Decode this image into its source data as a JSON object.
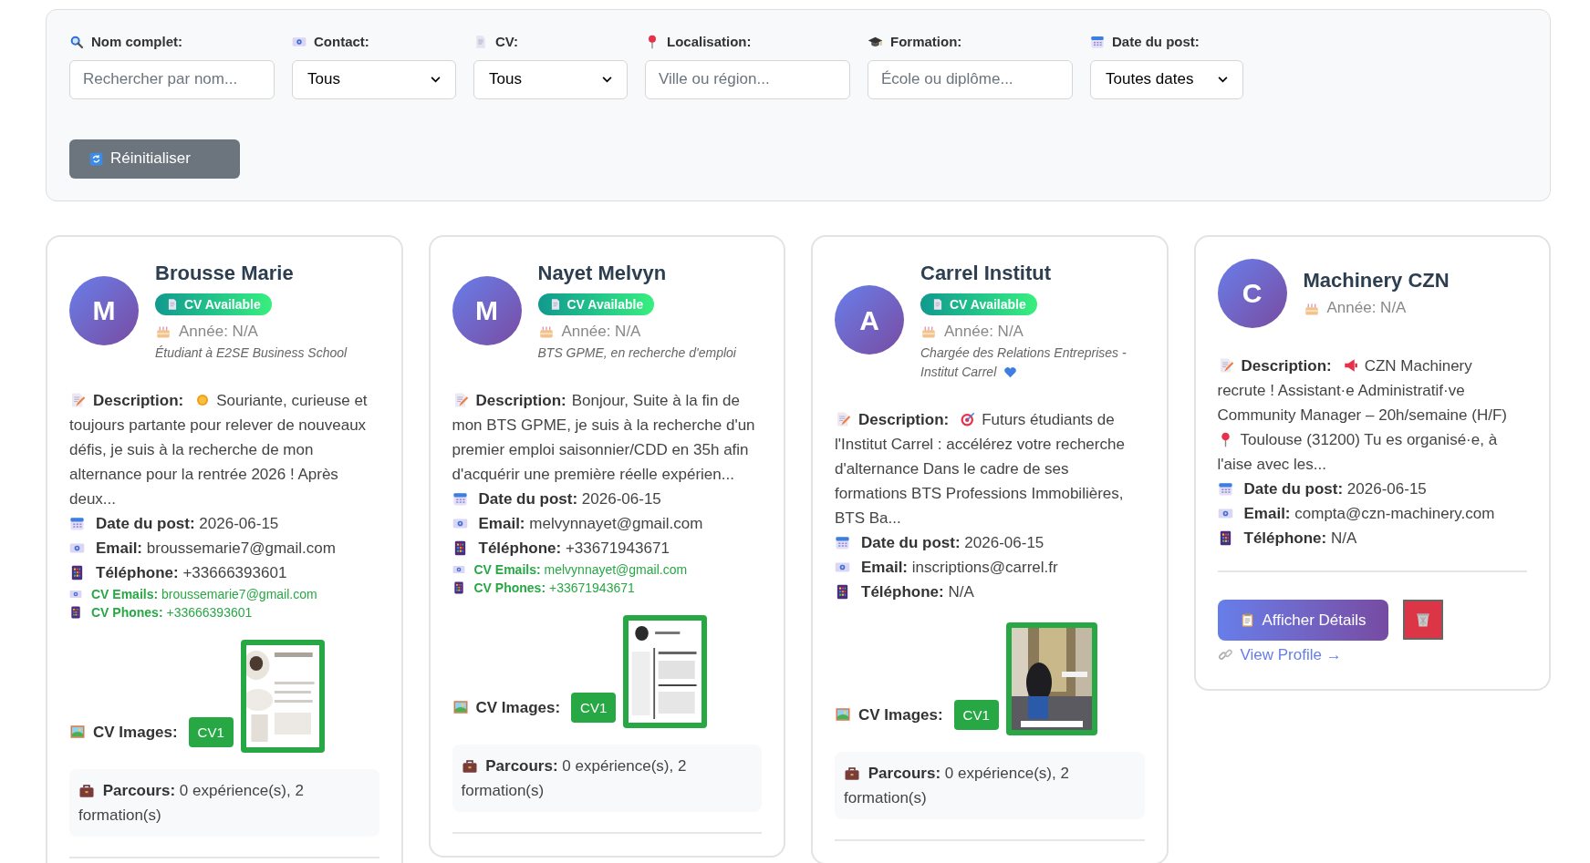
{
  "filters": [
    {
      "label": "Nom complet:",
      "kind": "text",
      "placeholder": "Rechercher par nom..."
    },
    {
      "label": "Contact:",
      "kind": "select",
      "value": "Tous"
    },
    {
      "label": "CV:",
      "kind": "select",
      "value": "Tous"
    },
    {
      "label": "Localisation:",
      "kind": "text",
      "placeholder": "Ville ou région..."
    },
    {
      "label": "Formation:",
      "kind": "text",
      "placeholder": "École ou diplôme..."
    },
    {
      "label": "Date du post:",
      "kind": "select",
      "value": "Toutes dates"
    }
  ],
  "reset_button": "Réinitialiser",
  "candidates": [
    {
      "avatar": "M",
      "name": "Brousse Marie",
      "cv_available": true,
      "cv_badge": "CV Available",
      "year": "Année: N/A",
      "headline": [
        {
          "kind": "text",
          "text": "Étudiant à E2SE Business School"
        }
      ],
      "description": {
        "label": "Description:",
        "parts": [
          {
            "kind": "sun"
          },
          {
            "kind": "text",
            "text": "Souriante, curieuse et"
          },
          {
            "kind": "paragraph",
            "text": "toujours partante pour relever de nouveaux défis, je suis à la recherche de mon alternance pour la rentrée 2026 ! Après deux..."
          }
        ]
      },
      "fields": [
        {
          "kind": "date",
          "label": "Date du post:",
          "value": "2026-06-15"
        },
        {
          "kind": "email",
          "label": "Email:",
          "value": "broussemarie7@gmail.com"
        },
        {
          "kind": "phone",
          "label": "Téléphone:",
          "value": "+33666393601"
        },
        {
          "kind": "cv_email",
          "label": "CV Emails:",
          "value": "broussemarie7@gmail.com"
        },
        {
          "kind": "cv_phone",
          "label": "CV Phones:",
          "value": "+33666393601"
        }
      ],
      "cv_images": {
        "label": "CV Images:",
        "buttons": [
          "CV1"
        ]
      },
      "parcours": {
        "label": "Parcours:",
        "text": "0 expérience(s), 2 formation(s)"
      }
    },
    {
      "avatar": "M",
      "name": "Nayet Melvyn",
      "cv_available": true,
      "cv_badge": "CV Available",
      "year": "Année: N/A",
      "headline": [
        {
          "kind": "text",
          "text": "BTS GPME, en recherche d'emploi"
        }
      ],
      "description": {
        "label": "Description:",
        "parts": [
          {
            "kind": "text",
            "text": "Bonjour, Suite à la fin de"
          },
          {
            "kind": "paragraph",
            "text": "mon BTS GPME, je suis à la recherche d'un premier emploi saisonnier/CDD en 35h afin d'acquérir une première réelle expérien..."
          }
        ]
      },
      "fields": [
        {
          "kind": "date",
          "label": "Date du post:",
          "value": "2026-06-15"
        },
        {
          "kind": "email",
          "label": "Email:",
          "value": "melvynnayet@gmail.com"
        },
        {
          "kind": "phone",
          "label": "Téléphone:",
          "value": "+33671943671"
        },
        {
          "kind": "cv_email",
          "label": "CV Emails:",
          "value": "melvynnayet@gmail.com"
        },
        {
          "kind": "cv_phone",
          "label": "CV Phones:",
          "value": "+33671943671"
        }
      ],
      "cv_images": {
        "label": "CV Images:",
        "buttons": [
          "CV1"
        ]
      },
      "parcours": {
        "label": "Parcours:",
        "text": "0 expérience(s), 2 formation(s)"
      }
    },
    {
      "avatar": "A",
      "name": "Carrel Institut",
      "cv_available": true,
      "cv_badge": "CV Available",
      "year": "Année: N/A",
      "headline": [
        {
          "kind": "text",
          "text": "Chargée des Relations Entreprises -"
        },
        {
          "kind": "text",
          "text": "Institut Carrel"
        },
        {
          "kind": "heart"
        }
      ],
      "description": {
        "label": "Description:",
        "parts": [
          {
            "kind": "target"
          },
          {
            "kind": "text",
            "text": "Futurs étudiants de"
          },
          {
            "kind": "paragraph",
            "text": "l'Institut Carrel : accélérez votre recherche d'alternance Dans le cadre de ses formations BTS Professions Immobilières, BTS Ba..."
          }
        ]
      },
      "fields": [
        {
          "kind": "date",
          "label": "Date du post:",
          "value": "2026-06-15"
        },
        {
          "kind": "email",
          "label": "Email:",
          "value": "inscriptions@carrel.fr"
        },
        {
          "kind": "phone",
          "label": "Téléphone:",
          "value": "N/A"
        }
      ],
      "cv_images": {
        "label": "CV Images:",
        "buttons": [
          "CV1"
        ]
      },
      "parcours": {
        "label": "Parcours:",
        "text": "0 expérience(s), 2 formation(s)"
      }
    },
    {
      "avatar": "C",
      "name": "Machinery CZN",
      "cv_available": false,
      "year": "Année: N/A",
      "description": {
        "label": "Description:",
        "parts": [
          {
            "kind": "megaphone"
          },
          {
            "kind": "text",
            "text": "CZN Machinery"
          },
          {
            "kind": "paragraph",
            "text": "recrute ! Assistant·e Administratif·ve Community Manager – 20h/semaine (H/F)"
          },
          {
            "kind": "pin"
          },
          {
            "kind": "text",
            "text": "Toulouse (31200) Tu es organisé·e, à"
          },
          {
            "kind": "paragraph",
            "text": "l'aise avec les..."
          }
        ]
      },
      "fields": [
        {
          "kind": "date",
          "label": "Date du post:",
          "value": "2026-06-15"
        },
        {
          "kind": "email",
          "label": "Email:",
          "value": "compta@czn-machinery.com"
        },
        {
          "kind": "phone",
          "label": "Téléphone:",
          "value": "N/A"
        }
      ],
      "actions": {
        "details": "Afficher Détails",
        "link": "View Profile →"
      }
    }
  ]
}
